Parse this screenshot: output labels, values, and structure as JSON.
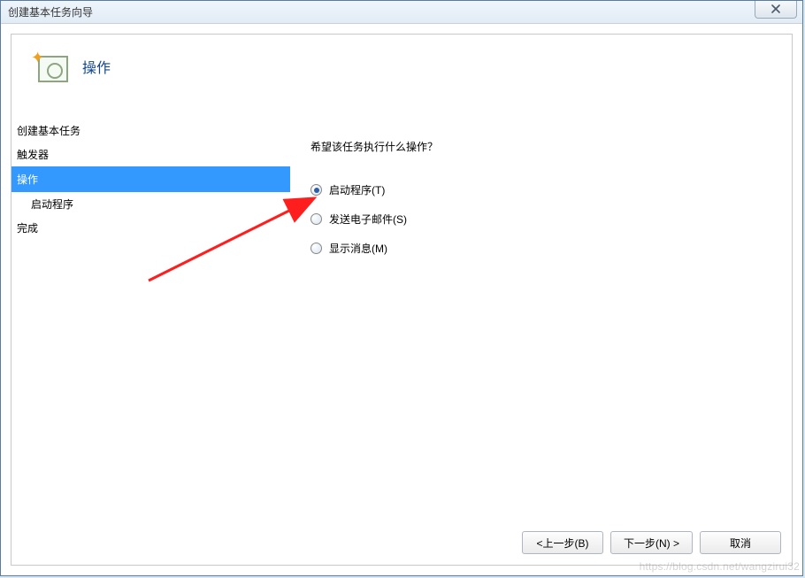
{
  "window": {
    "title": "创建基本任务向导"
  },
  "header": {
    "title": "操作"
  },
  "sidebar": {
    "items": [
      {
        "label": "创建基本任务",
        "indent": false,
        "active": false
      },
      {
        "label": "触发器",
        "indent": false,
        "active": false
      },
      {
        "label": "操作",
        "indent": false,
        "active": true
      },
      {
        "label": "启动程序",
        "indent": true,
        "active": false
      },
      {
        "label": "完成",
        "indent": false,
        "active": false
      }
    ]
  },
  "main": {
    "question": "希望该任务执行什么操作？",
    "options": [
      {
        "label": "启动程序(T)",
        "selected": true
      },
      {
        "label": "发送电子邮件(S)",
        "selected": false
      },
      {
        "label": "显示消息(M)",
        "selected": false
      }
    ]
  },
  "buttons": {
    "back": "<上一步(B)",
    "next": "下一步(N) >",
    "cancel": "取消"
  },
  "watermark": "https://blog.csdn.net/wangzirui32"
}
